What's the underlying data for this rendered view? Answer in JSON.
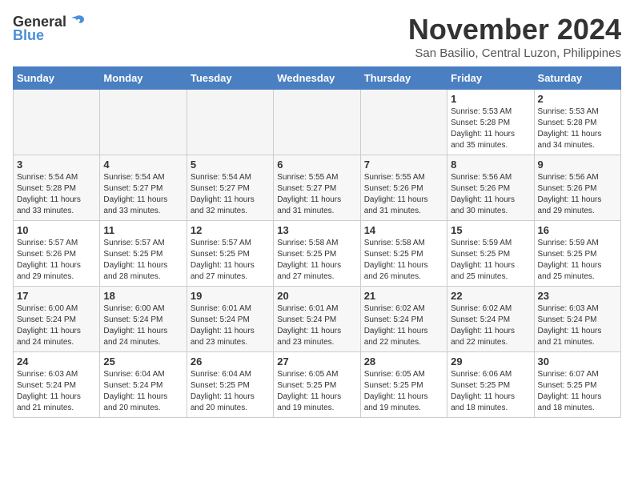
{
  "logo": {
    "general": "General",
    "blue": "Blue"
  },
  "title": "November 2024",
  "subtitle": "San Basilio, Central Luzon, Philippines",
  "days_of_week": [
    "Sunday",
    "Monday",
    "Tuesday",
    "Wednesday",
    "Thursday",
    "Friday",
    "Saturday"
  ],
  "weeks": [
    [
      {
        "day": "",
        "info": ""
      },
      {
        "day": "",
        "info": ""
      },
      {
        "day": "",
        "info": ""
      },
      {
        "day": "",
        "info": ""
      },
      {
        "day": "",
        "info": ""
      },
      {
        "day": "1",
        "info": "Sunrise: 5:53 AM\nSunset: 5:28 PM\nDaylight: 11 hours\nand 35 minutes."
      },
      {
        "day": "2",
        "info": "Sunrise: 5:53 AM\nSunset: 5:28 PM\nDaylight: 11 hours\nand 34 minutes."
      }
    ],
    [
      {
        "day": "3",
        "info": "Sunrise: 5:54 AM\nSunset: 5:28 PM\nDaylight: 11 hours\nand 33 minutes."
      },
      {
        "day": "4",
        "info": "Sunrise: 5:54 AM\nSunset: 5:27 PM\nDaylight: 11 hours\nand 33 minutes."
      },
      {
        "day": "5",
        "info": "Sunrise: 5:54 AM\nSunset: 5:27 PM\nDaylight: 11 hours\nand 32 minutes."
      },
      {
        "day": "6",
        "info": "Sunrise: 5:55 AM\nSunset: 5:27 PM\nDaylight: 11 hours\nand 31 minutes."
      },
      {
        "day": "7",
        "info": "Sunrise: 5:55 AM\nSunset: 5:26 PM\nDaylight: 11 hours\nand 31 minutes."
      },
      {
        "day": "8",
        "info": "Sunrise: 5:56 AM\nSunset: 5:26 PM\nDaylight: 11 hours\nand 30 minutes."
      },
      {
        "day": "9",
        "info": "Sunrise: 5:56 AM\nSunset: 5:26 PM\nDaylight: 11 hours\nand 29 minutes."
      }
    ],
    [
      {
        "day": "10",
        "info": "Sunrise: 5:57 AM\nSunset: 5:26 PM\nDaylight: 11 hours\nand 29 minutes."
      },
      {
        "day": "11",
        "info": "Sunrise: 5:57 AM\nSunset: 5:25 PM\nDaylight: 11 hours\nand 28 minutes."
      },
      {
        "day": "12",
        "info": "Sunrise: 5:57 AM\nSunset: 5:25 PM\nDaylight: 11 hours\nand 27 minutes."
      },
      {
        "day": "13",
        "info": "Sunrise: 5:58 AM\nSunset: 5:25 PM\nDaylight: 11 hours\nand 27 minutes."
      },
      {
        "day": "14",
        "info": "Sunrise: 5:58 AM\nSunset: 5:25 PM\nDaylight: 11 hours\nand 26 minutes."
      },
      {
        "day": "15",
        "info": "Sunrise: 5:59 AM\nSunset: 5:25 PM\nDaylight: 11 hours\nand 25 minutes."
      },
      {
        "day": "16",
        "info": "Sunrise: 5:59 AM\nSunset: 5:25 PM\nDaylight: 11 hours\nand 25 minutes."
      }
    ],
    [
      {
        "day": "17",
        "info": "Sunrise: 6:00 AM\nSunset: 5:24 PM\nDaylight: 11 hours\nand 24 minutes."
      },
      {
        "day": "18",
        "info": "Sunrise: 6:00 AM\nSunset: 5:24 PM\nDaylight: 11 hours\nand 24 minutes."
      },
      {
        "day": "19",
        "info": "Sunrise: 6:01 AM\nSunset: 5:24 PM\nDaylight: 11 hours\nand 23 minutes."
      },
      {
        "day": "20",
        "info": "Sunrise: 6:01 AM\nSunset: 5:24 PM\nDaylight: 11 hours\nand 23 minutes."
      },
      {
        "day": "21",
        "info": "Sunrise: 6:02 AM\nSunset: 5:24 PM\nDaylight: 11 hours\nand 22 minutes."
      },
      {
        "day": "22",
        "info": "Sunrise: 6:02 AM\nSunset: 5:24 PM\nDaylight: 11 hours\nand 22 minutes."
      },
      {
        "day": "23",
        "info": "Sunrise: 6:03 AM\nSunset: 5:24 PM\nDaylight: 11 hours\nand 21 minutes."
      }
    ],
    [
      {
        "day": "24",
        "info": "Sunrise: 6:03 AM\nSunset: 5:24 PM\nDaylight: 11 hours\nand 21 minutes."
      },
      {
        "day": "25",
        "info": "Sunrise: 6:04 AM\nSunset: 5:24 PM\nDaylight: 11 hours\nand 20 minutes."
      },
      {
        "day": "26",
        "info": "Sunrise: 6:04 AM\nSunset: 5:25 PM\nDaylight: 11 hours\nand 20 minutes."
      },
      {
        "day": "27",
        "info": "Sunrise: 6:05 AM\nSunset: 5:25 PM\nDaylight: 11 hours\nand 19 minutes."
      },
      {
        "day": "28",
        "info": "Sunrise: 6:05 AM\nSunset: 5:25 PM\nDaylight: 11 hours\nand 19 minutes."
      },
      {
        "day": "29",
        "info": "Sunrise: 6:06 AM\nSunset: 5:25 PM\nDaylight: 11 hours\nand 18 minutes."
      },
      {
        "day": "30",
        "info": "Sunrise: 6:07 AM\nSunset: 5:25 PM\nDaylight: 11 hours\nand 18 minutes."
      }
    ]
  ]
}
